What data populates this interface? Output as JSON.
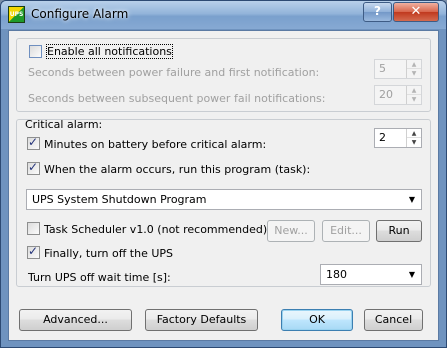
{
  "window": {
    "title": "Configure Alarm",
    "icon_text": "UPS",
    "help_label": "?",
    "close_label": "✕"
  },
  "notifications": {
    "enable_all_label": "Enable all notifications",
    "enable_all_checked": false,
    "first_delay_label": "Seconds between power failure and first notification:",
    "first_delay_value": "5",
    "subsequent_delay_label": "Seconds between subsequent power fail notifications:",
    "subsequent_delay_value": "20"
  },
  "critical": {
    "group_label": "Critical alarm:",
    "minutes_label": "Minutes on battery before critical alarm:",
    "minutes_checked": true,
    "minutes_value": "2",
    "run_program_label": "When the alarm occurs, run this program (task):",
    "run_program_checked": true,
    "program_selected": "UPS System Shutdown Program",
    "task_scheduler_label": "Task Scheduler v1.0 (not recommended)",
    "task_scheduler_checked": false,
    "new_label": "New...",
    "edit_label": "Edit...",
    "run_label": "Run",
    "turn_off_label": "Finally, turn off the UPS",
    "turn_off_checked": true,
    "wait_time_label": "Turn UPS off wait time [s]:",
    "wait_time_value": "180"
  },
  "footer": {
    "advanced_label": "Advanced...",
    "factory_defaults_label": "Factory Defaults",
    "ok_label": "OK",
    "cancel_label": "Cancel"
  }
}
